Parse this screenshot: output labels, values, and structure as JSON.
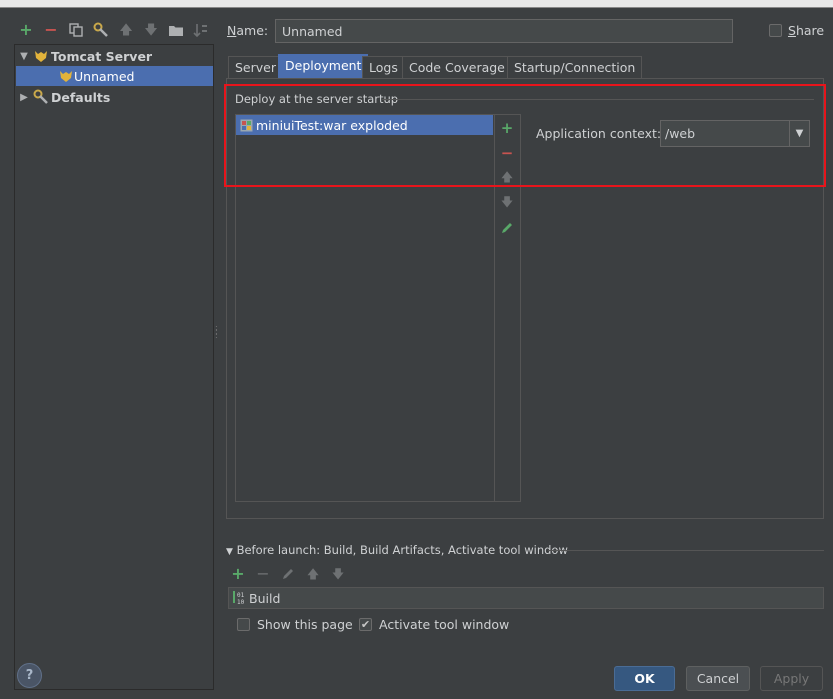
{
  "toolbar": {
    "add": "+",
    "remove": "−",
    "copy_icon": "copy-icon",
    "settings_icon": "wrench-icon",
    "up": "🡅",
    "down": "🡇",
    "folder_icon": "folder-icon",
    "sort_icon": "sort-icon"
  },
  "tree": {
    "group_label": "Tomcat Server",
    "child_label": "Unnamed",
    "defaults_label": "Defaults"
  },
  "name": {
    "label": "Name:",
    "value": "Unnamed"
  },
  "share": {
    "label": "Share",
    "checked": false
  },
  "tabs": [
    {
      "label": "Server"
    },
    {
      "label": "Deployment"
    },
    {
      "label": "Logs"
    },
    {
      "label": "Code Coverage"
    },
    {
      "label": "Startup/Connection"
    }
  ],
  "deployment": {
    "group_title": "Deploy at the server startup",
    "items": [
      {
        "label": "miniuiTest:war exploded"
      }
    ],
    "context_label": "Application context:",
    "context_value": "/web"
  },
  "before_launch": {
    "title": "Before launch: Build, Build Artifacts, Activate tool window",
    "items": [
      {
        "label": "Build"
      }
    ]
  },
  "options": {
    "show_page_label": "Show this page",
    "show_page_checked": false,
    "activate_label": "Activate tool window",
    "activate_checked": true
  },
  "buttons": {
    "help": "?",
    "ok": "OK",
    "cancel": "Cancel",
    "apply": "Apply"
  },
  "colors": {
    "background": "#3c3f41",
    "selection": "#4b6eaf",
    "highlight": "#e8141b",
    "add_green": "#59a869",
    "remove_red": "#c75450"
  }
}
